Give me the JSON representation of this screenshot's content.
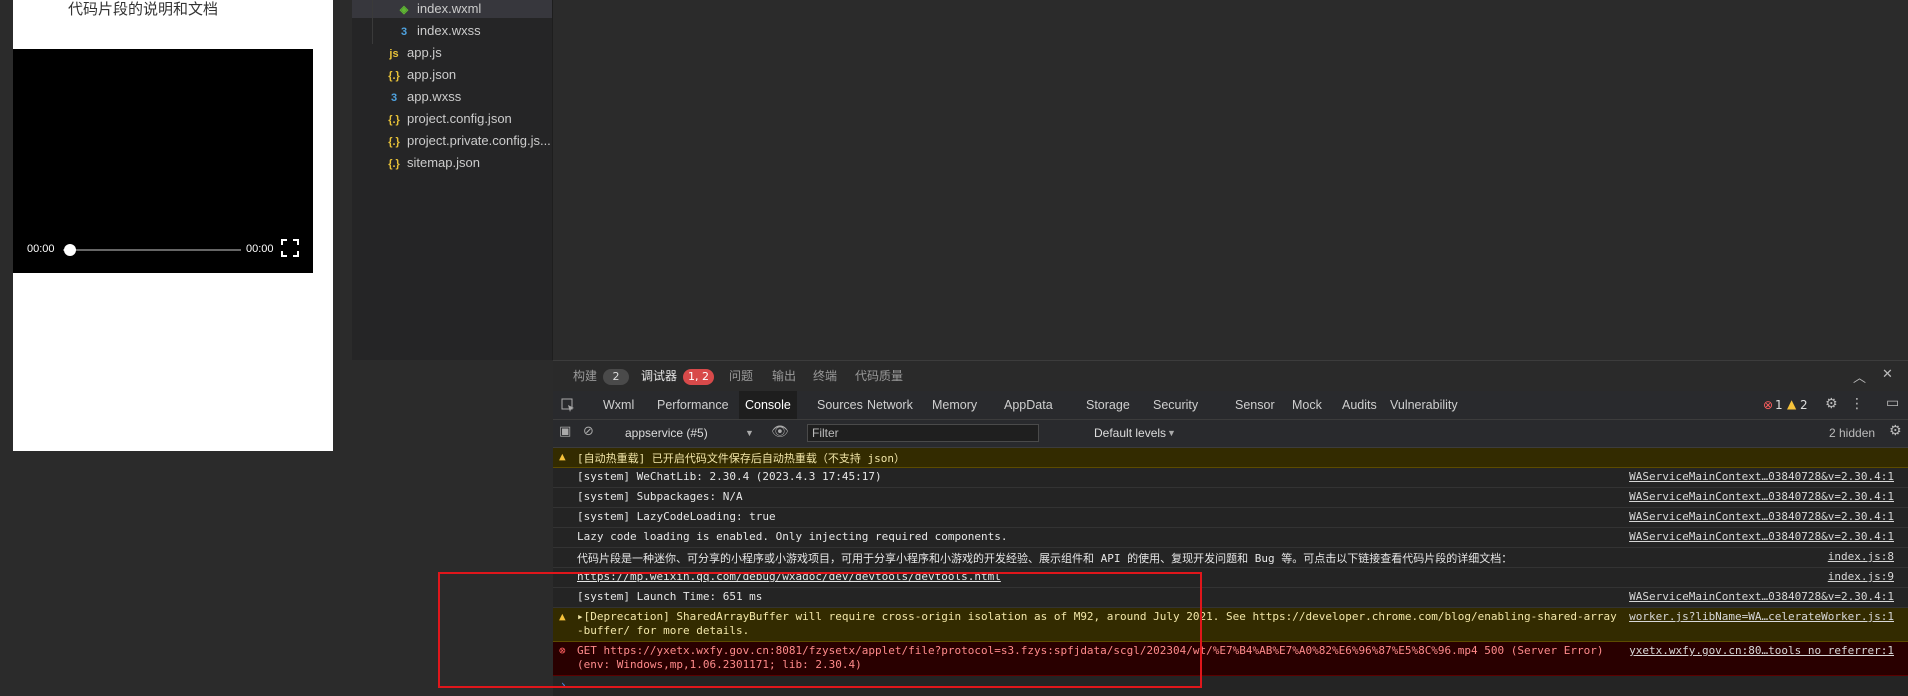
{
  "simulator": {
    "title": "代码片段的说明和文档",
    "video": {
      "current_time": "00:00",
      "duration": "00:00",
      "progress": 0
    }
  },
  "file_tree": {
    "items": [
      {
        "name": "index.wxml",
        "icon": "wxml-file-icon",
        "indent": 2
      },
      {
        "name": "index.wxss",
        "icon": "wxss-file-icon",
        "indent": 2
      },
      {
        "name": "app.js",
        "icon": "js-file-icon",
        "indent": 1
      },
      {
        "name": "app.json",
        "icon": "json-file-icon",
        "indent": 1
      },
      {
        "name": "app.wxss",
        "icon": "wxss-file-icon",
        "indent": 1
      },
      {
        "name": "project.config.json",
        "icon": "json-file-icon",
        "indent": 1
      },
      {
        "name": "project.private.config.js...",
        "icon": "json-file-icon",
        "indent": 1
      },
      {
        "name": "sitemap.json",
        "icon": "json-file-icon",
        "indent": 1
      }
    ]
  },
  "dock": {
    "tabs": [
      {
        "label": "构建",
        "badge": "2"
      },
      {
        "label": "调试器",
        "badge": "1, 2",
        "active": true
      },
      {
        "label": "问题"
      },
      {
        "label": "输出"
      },
      {
        "label": "终端"
      },
      {
        "label": "代码质量"
      }
    ],
    "devtools_tabs": [
      "Wxml",
      "Performance",
      "Console",
      "Sources",
      "Network",
      "Memory",
      "AppData",
      "Storage",
      "Security",
      "Sensor",
      "Mock",
      "Audits",
      "Vulnerability"
    ],
    "active_devtab": "Console",
    "error_count": "1",
    "warning_count": "2",
    "context": "appservice (#5)",
    "filter_placeholder": "Filter",
    "levels": "Default levels",
    "hidden": "2 hidden"
  },
  "console": {
    "messages": [
      {
        "type": "warn",
        "text": "[自动热重载] 已开启代码文件保存后自动热重载（不支持 json）",
        "source": ""
      },
      {
        "type": "log",
        "text": "[system] WeChatLib: 2.30.4 (2023.4.3 17:45:17)",
        "source": "WAServiceMainContext…03840728&v=2.30.4:1"
      },
      {
        "type": "log",
        "text": "[system] Subpackages: N/A",
        "source": "WAServiceMainContext…03840728&v=2.30.4:1"
      },
      {
        "type": "log",
        "text": "[system] LazyCodeLoading: true",
        "source": "WAServiceMainContext…03840728&v=2.30.4:1"
      },
      {
        "type": "log",
        "text": "Lazy code loading is enabled. Only injecting required components.",
        "source": "WAServiceMainContext…03840728&v=2.30.4:1"
      },
      {
        "type": "log",
        "text": "代码片段是一种迷你、可分享的小程序或小游戏项目，可用于分享小程序和小游戏的开发经验、展示组件和 API 的使用、复现开发问题和 Bug 等。可点击以下链接查看代码片段的详细文档：",
        "source": "index.js:8"
      },
      {
        "type": "log",
        "text": "https://mp.weixin.qq.com/debug/wxadoc/dev/devtools/devtools.html",
        "source": "index.js:9"
      },
      {
        "type": "log",
        "text": "[system] Launch Time: 651 ms",
        "source": "WAServiceMainContext…03840728&v=2.30.4:1"
      },
      {
        "type": "warn",
        "text": "▸[Deprecation] SharedArrayBuffer will require cross-origin isolation as of M92, around July 2021. See https://developer.chrome.com/blog/enabling-shared-array",
        "text2": "-buffer/ for more details.",
        "source": "worker.js?libName=WA…celerateWorker.js:1"
      },
      {
        "type": "error",
        "text": "GET https://yxetx.wxfy.gov.cn:8081/fzysetx/applet/file?protocol=s3.fzys:spfjdata/scgl/202304/wt/%E7%B4%AB%E7%A0%82%E6%96%87%E5%8C%96.mp4 500 (Server Error)",
        "text2": "(env: Windows,mp,1.06.2301171; lib: 2.30.4)",
        "source": "yxetx.wxfy.gov.cn:80…tools no referrer:1"
      }
    ]
  },
  "colors": {
    "highlight": "#e0161b",
    "error_badge": "#d84a4a"
  }
}
